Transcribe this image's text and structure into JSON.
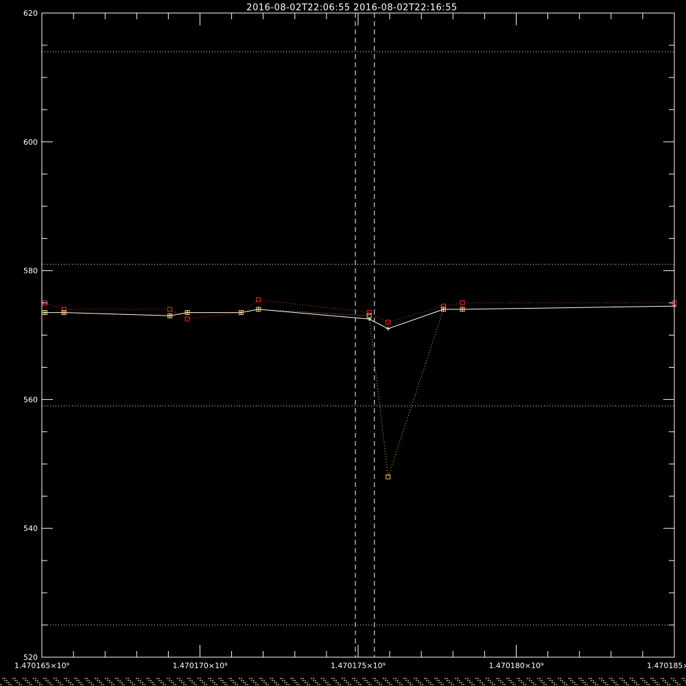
{
  "chart_data": {
    "type": "line",
    "title": "2016-08-02T22:06:55  2016-08-02T22:16:55",
    "xlabel": "",
    "ylabel": "",
    "xlim": [
      1470165000,
      1470185000
    ],
    "ylim": [
      520,
      620
    ],
    "x_ticks": [
      1470165000,
      1470170000,
      1470175000,
      1470180000,
      1470185000
    ],
    "x_tick_labels": [
      "1.470165×10⁹",
      "1.470170×10⁹",
      "1.470175×10⁹",
      "1.470180×10⁹",
      "1.470185×10⁹"
    ],
    "y_ticks": [
      520,
      540,
      560,
      580,
      600,
      620
    ],
    "y_tick_labels": [
      "520",
      "540",
      "560",
      "580",
      "600",
      "620"
    ],
    "y_minor_step": 5,
    "x_minor_step": 1000,
    "horizontal_reference_lines": [
      614,
      581,
      559,
      525
    ],
    "vertical_markers": [
      1470174915,
      1470175515
    ],
    "colors": {
      "background": "#000000",
      "axes": "#ffffff",
      "main_line": "#ffffff",
      "red_squares": "#ff2a2a",
      "orange_squares": "#ffcc66",
      "reference_lines": "#ffff99",
      "red_dotted": "#ff3333",
      "orange_dotted": "#ffcc44"
    },
    "series": [
      {
        "style": "white-solid-plus",
        "x": [
          1470165100,
          1470165700,
          1470169050,
          1470169600,
          1470171300,
          1470171850,
          1470175350,
          1470175950,
          1470177700,
          1470178300,
          1470185000
        ],
        "y": [
          573.5,
          573.5,
          573.0,
          573.5,
          573.5,
          574.0,
          572.5,
          571.0,
          574.0,
          574.0,
          574.5
        ]
      },
      {
        "style": "red-dotted-square",
        "x": [
          1470165100,
          1470165700,
          1470169050,
          1470169600,
          1470171300,
          1470171850,
          1470175350,
          1470175950,
          1470177700,
          1470178300,
          1470185000
        ],
        "y": [
          575.0,
          574.0,
          574.0,
          572.5,
          573.5,
          575.5,
          573.5,
          572.0,
          574.5,
          575.0,
          575.0
        ]
      },
      {
        "style": "orange-dotted-square",
        "x": [
          1470165100,
          1470165700,
          1470169050,
          1470169600,
          1470171300,
          1470171850,
          1470175350,
          1470175950,
          1470177700,
          1470178300
        ],
        "y": [
          573.5,
          573.5,
          573.0,
          573.5,
          573.5,
          574.0,
          573.0,
          548.0,
          574.0,
          574.0
        ]
      }
    ]
  }
}
